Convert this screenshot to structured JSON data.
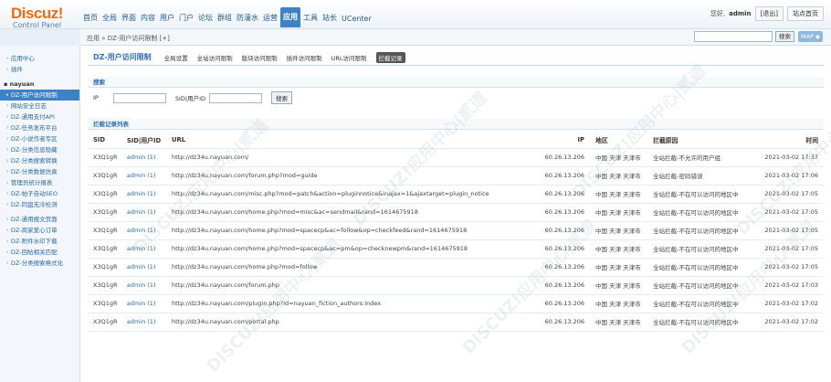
{
  "logo": {
    "brand": "Discuz!",
    "sub": "Control Panel"
  },
  "nav": [
    "首页",
    "全局",
    "界面",
    "内容",
    "用户",
    "门户",
    "论坛",
    "群组",
    "防灌水",
    "运营",
    "应用",
    "工具",
    "站长",
    "UCenter"
  ],
  "nav_active_index": 10,
  "header": {
    "greeting": "您好,",
    "user": "admin",
    "logout": "[退出]",
    "home": "站点首页"
  },
  "crumb": "应用 » DZ-用户访问限制 [+]",
  "search": {
    "button": "搜索",
    "map": "MAP ◆"
  },
  "sidebar": [
    {
      "label": "应用中心",
      "type": "item"
    },
    {
      "label": "插件",
      "type": "item"
    },
    {
      "label": "gap",
      "type": "gap"
    },
    {
      "label": "nayuan",
      "type": "grp"
    },
    {
      "label": "DZ-用户访问限制",
      "type": "active"
    },
    {
      "label": "网站安全日志",
      "type": "item"
    },
    {
      "label": "DZ-通用支付API",
      "type": "item"
    },
    {
      "label": "DZ-任务发布平台",
      "type": "item"
    },
    {
      "label": "DZ-小说作者专区",
      "type": "item"
    },
    {
      "label": "DZ-分类信息隐藏",
      "type": "item"
    },
    {
      "label": "DZ-分类搜索转换",
      "type": "item"
    },
    {
      "label": "DZ-分类数据仿真",
      "type": "item"
    },
    {
      "label": "管理员统计报表",
      "type": "item"
    },
    {
      "label": "DZ-帖子自动SEO",
      "type": "item"
    },
    {
      "label": "DZ-同盘无冷检测",
      "type": "item"
    },
    {
      "label": "gap",
      "type": "gap"
    },
    {
      "label": "DZ-通用搜文页面",
      "type": "item"
    },
    {
      "label": "DZ-商家爱心订单",
      "type": "item"
    },
    {
      "label": "DZ-附件水印下载",
      "type": "item"
    },
    {
      "label": "DZ-回帖相关匹配",
      "type": "item"
    },
    {
      "label": "DZ-分类搜索格式化",
      "type": "item"
    }
  ],
  "tabs": {
    "title": "DZ-用户访问限制",
    "items": [
      "全局设置",
      "全站访问限制",
      "版块访问限制",
      "插件访问限制",
      "URL访问限制",
      "拦截记录"
    ],
    "active_index": 5
  },
  "search_section": {
    "title": "搜索",
    "ip_label": "IP",
    "sid_label": "SID|用户ID",
    "button": "搜索"
  },
  "list_section": {
    "title": "拦截记录列表"
  },
  "table": {
    "headers": [
      "SID",
      "SID|用户ID",
      "URL",
      "IP",
      "地区",
      "拦截原因",
      "时间"
    ],
    "rows": [
      [
        "X3Q1gR",
        "admin (1)",
        "http://dz34u.nayuan.com/",
        "60.26.13.206",
        "中国 天津 天津市",
        "全站拦截-不允许的用户组",
        "2021-03-02 17:37"
      ],
      [
        "X3Q1gR",
        "admin (1)",
        "http://dz34u.nayuan.com/forum.php?mod=guide",
        "60.26.13.206",
        "中国 天津 天津市",
        "全站拦截-密码错误",
        "2021-03-02 17:06"
      ],
      [
        "X3Q1gR",
        "admin (1)",
        "http://dz34u.nayuan.com/misc.php?mod=patch&action=pluginnotice&inajax=1&ajaxtarget=plugin_notice",
        "60.26.13.206",
        "中国 天津 天津市",
        "全站拦截-不在可以访问的地区中",
        "2021-03-02 17:05"
      ],
      [
        "X3Q1gR",
        "admin (1)",
        "http://dz34u.nayuan.com/home.php?mod=misc&ac=sendmail&rand=1614675918",
        "60.26.13.206",
        "中国 天津 天津市",
        "全站拦截-不在可以访问的地区中",
        "2021-03-02 17:05"
      ],
      [
        "X3Q1gR",
        "admin (1)",
        "http://dz34u.nayuan.com/home.php?mod=spacecp&ac=follow&op=checkfeed&rand=1614675918",
        "60.26.13.206",
        "中国 天津 天津市",
        "全站拦截-不在可以访问的地区中",
        "2021-03-02 17:05"
      ],
      [
        "X3Q1gR",
        "admin (1)",
        "http://dz34u.nayuan.com/home.php?mod=spacecp&ac=pm&op=checknewpm&rand=1614675918",
        "60.26.13.206",
        "中国 天津 天津市",
        "全站拦截-不在可以访问的地区中",
        "2021-03-02 17:05"
      ],
      [
        "X3Q1gR",
        "admin (1)",
        "http://dz34u.nayuan.com/home.php?mod=follow",
        "60.26.13.206",
        "中国 天津 天津市",
        "全站拦截-不在可以访问的地区中",
        "2021-03-02 17:05"
      ],
      [
        "X3Q1gR",
        "admin (1)",
        "http://dz34u.nayuan.com/forum.php",
        "60.26.13.206",
        "中国 天津 天津市",
        "全站拦截-不在可以访问的地区中",
        "2021-03-02 17:03"
      ],
      [
        "X3Q1gR",
        "admin (1)",
        "http://dz34u.nayuan.com/plugin.php?id=nayuan_fiction_authors:index",
        "60.26.13.206",
        "中国 天津 天津市",
        "全站拦截-不在可以访问的地区中",
        "2021-03-02 17:02"
      ],
      [
        "X3Q1gR",
        "admin (1)",
        "http://dz34u.nayuan.com/portal.php",
        "60.26.13.206",
        "中国 天津 天津市",
        "全站拦截-不在可以访问的地区中",
        "2021-03-02 17:02"
      ]
    ]
  },
  "watermark": "DISCUZ!应用中心|贰道"
}
